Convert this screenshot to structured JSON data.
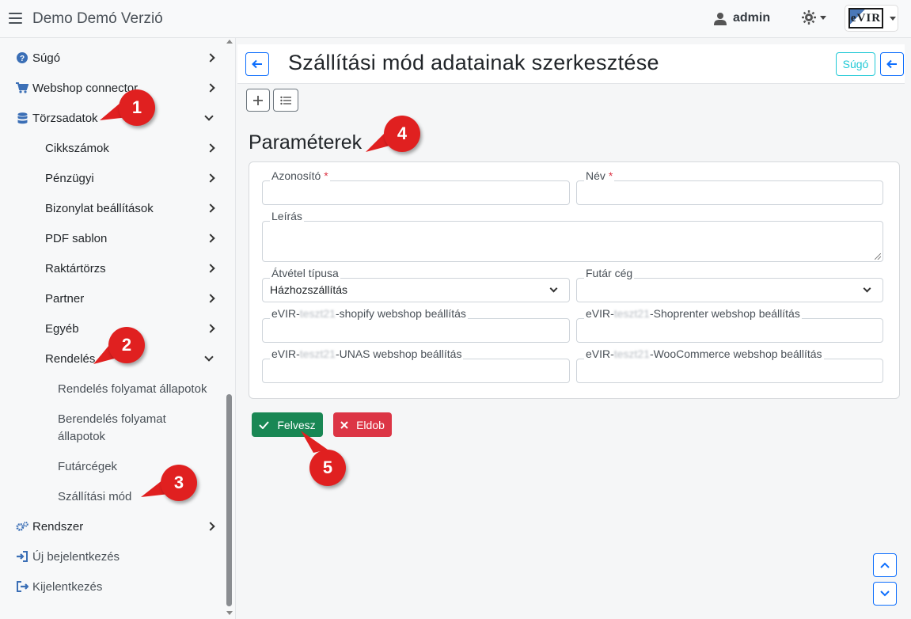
{
  "app": {
    "title": "Demo Demó Verzió",
    "user": "admin",
    "logo_text": "eVIR"
  },
  "colors": {
    "primary": "#0d6efd",
    "success": "#198754",
    "danger": "#dc3545",
    "info": "#20c9d6",
    "callout": "#e02020"
  },
  "sidebar": {
    "items": [
      {
        "label": "Súgó",
        "icon": "question-circle-icon"
      },
      {
        "label": "Webshop connector",
        "icon": "cart-icon"
      },
      {
        "label": "Törzsadatok",
        "icon": "database-icon"
      },
      {
        "label": "Cikkszámok"
      },
      {
        "label": "Pénzügyi"
      },
      {
        "label": "Bizonylat beállítások"
      },
      {
        "label": "PDF sablon"
      },
      {
        "label": "Raktártörzs"
      },
      {
        "label": "Partner"
      },
      {
        "label": "Egyéb"
      },
      {
        "label": "Rendelés"
      },
      {
        "label": "Rendelés folyamat állapotok"
      },
      {
        "label": "Berendelés folyamat állapotok"
      },
      {
        "label": "Futárcégek"
      },
      {
        "label": "Szállítási mód"
      },
      {
        "label": "Rendszer",
        "icon": "cogs-icon"
      },
      {
        "label": "Új bejelentkezés",
        "icon": "sign-in-icon"
      },
      {
        "label": "Kijelentkezés",
        "icon": "sign-out-icon"
      }
    ]
  },
  "page": {
    "title": "Szállítási mód adatainak szerkesztése",
    "help_label": "Súgó"
  },
  "form": {
    "section_title": "Paraméterek",
    "id_label": "Azonosító",
    "name_label": "Név",
    "required_mark": "*",
    "description_label": "Leírás",
    "pickup_type_label": "Átvétel típusa",
    "pickup_type_value": "Házhozszállítás",
    "courier_label": "Futár cég",
    "courier_value": "",
    "shopify_prefix": "eVIR-",
    "shopify_blur": "teszt21",
    "shopify_suffix": "-shopify webshop beállítás",
    "shoprenter_prefix": "eVIR-",
    "shoprenter_blur": "teszt21",
    "shoprenter_suffix": "-Shoprenter webshop beállítás",
    "unas_prefix": "eVIR-",
    "unas_blur": "teszt21",
    "unas_suffix": "-UNAS webshop beállítás",
    "woo_prefix": "eVIR-",
    "woo_blur": "teszt21",
    "woo_suffix": "-WooCommerce webshop beállítás"
  },
  "actions": {
    "save_label": "Felvesz",
    "discard_label": "Eldob"
  },
  "callouts": [
    "1",
    "2",
    "3",
    "4",
    "5"
  ]
}
